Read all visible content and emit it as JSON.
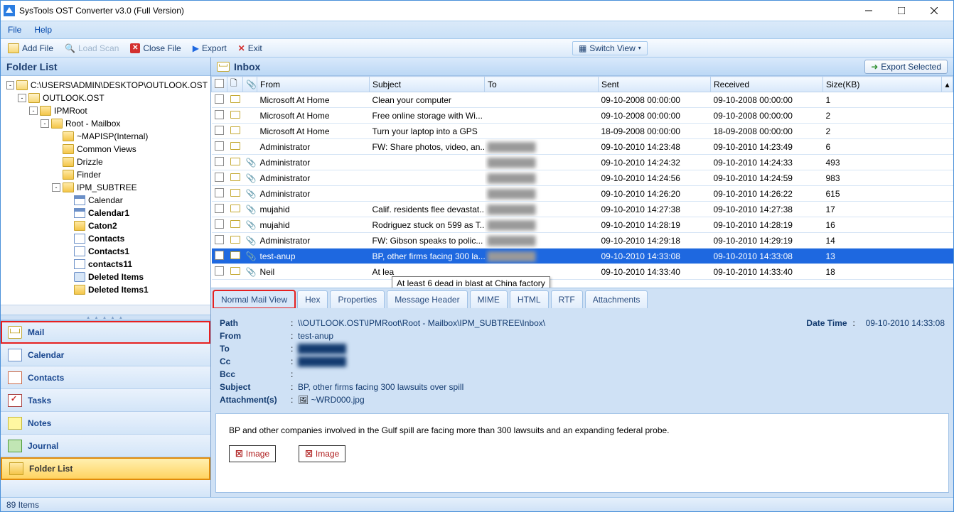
{
  "window": {
    "title": "SysTools OST Converter v3.0 (Full Version)"
  },
  "menu": {
    "file": "File",
    "help": "Help"
  },
  "toolbar": {
    "add_file": "Add File",
    "load_scan": "Load Scan",
    "close_file": "Close File",
    "export": "Export",
    "exit": "Exit",
    "switch_view": "Switch View"
  },
  "left": {
    "header": "Folder List",
    "tree": [
      {
        "depth": 0,
        "exp": "-",
        "icon": "folder-open",
        "label": "C:\\USERS\\ADMIN\\DESKTOP\\OUTLOOK.OST"
      },
      {
        "depth": 1,
        "exp": "-",
        "icon": "folder-open",
        "label": "OUTLOOK.OST"
      },
      {
        "depth": 2,
        "exp": "-",
        "icon": "folder",
        "label": "IPMRoot"
      },
      {
        "depth": 3,
        "exp": "-",
        "icon": "folder",
        "label": "Root - Mailbox"
      },
      {
        "depth": 4,
        "exp": "",
        "icon": "folder",
        "label": "~MAPISP(Internal)"
      },
      {
        "depth": 4,
        "exp": "",
        "icon": "folder",
        "label": "Common Views"
      },
      {
        "depth": 4,
        "exp": "",
        "icon": "folder",
        "label": "Drizzle"
      },
      {
        "depth": 4,
        "exp": "",
        "icon": "folder",
        "label": "Finder"
      },
      {
        "depth": 4,
        "exp": "-",
        "icon": "folder",
        "label": "IPM_SUBTREE"
      },
      {
        "depth": 5,
        "exp": "",
        "icon": "cal",
        "label": "Calendar"
      },
      {
        "depth": 5,
        "exp": "",
        "icon": "cal",
        "label": "Calendar1",
        "bold": true
      },
      {
        "depth": 5,
        "exp": "",
        "icon": "folder",
        "label": "Caton2",
        "bold": true
      },
      {
        "depth": 5,
        "exp": "",
        "icon": "contacts",
        "label": "Contacts",
        "bold": true
      },
      {
        "depth": 5,
        "exp": "",
        "icon": "contacts",
        "label": "Contacts1",
        "bold": true
      },
      {
        "depth": 5,
        "exp": "",
        "icon": "contacts",
        "label": "contacts11",
        "bold": true
      },
      {
        "depth": 5,
        "exp": "",
        "icon": "trash",
        "label": "Deleted Items",
        "bold": true
      },
      {
        "depth": 5,
        "exp": "",
        "icon": "folder",
        "label": "Deleted Items1",
        "bold": true
      }
    ],
    "nav": [
      {
        "label": "Mail",
        "icon": "mail",
        "sel": false,
        "hl": true
      },
      {
        "label": "Calendar",
        "icon": "cal"
      },
      {
        "label": "Contacts",
        "icon": "con"
      },
      {
        "label": "Tasks",
        "icon": "task"
      },
      {
        "label": "Notes",
        "icon": "note"
      },
      {
        "label": "Journal",
        "icon": "jour"
      },
      {
        "label": "Folder List",
        "icon": "fl",
        "sel": true
      }
    ]
  },
  "list": {
    "title": "Inbox",
    "export_selected": "Export Selected",
    "cols": {
      "from": "From",
      "subject": "Subject",
      "to": "To",
      "sent": "Sent",
      "received": "Received",
      "size": "Size(KB)"
    },
    "rows": [
      {
        "from": "Microsoft At Home",
        "subject": "Clean your computer",
        "to": "",
        "sent": "09-10-2008 00:00:00",
        "received": "09-10-2008 00:00:00",
        "size": "1",
        "att": false
      },
      {
        "from": "Microsoft At Home",
        "subject": "Free online storage with Wi...",
        "to": "",
        "sent": "09-10-2008 00:00:00",
        "received": "09-10-2008 00:00:00",
        "size": "2",
        "att": false
      },
      {
        "from": "Microsoft At Home",
        "subject": "Turn your laptop into a GPS",
        "to": "",
        "sent": "18-09-2008 00:00:00",
        "received": "18-09-2008 00:00:00",
        "size": "2",
        "att": false
      },
      {
        "from": "Administrator",
        "subject": "FW: Share photos, video, an...",
        "to": "████████",
        "sent": "09-10-2010 14:23:48",
        "received": "09-10-2010 14:23:49",
        "size": "6",
        "att": false
      },
      {
        "from": "Administrator",
        "subject": "",
        "to": "████████",
        "sent": "09-10-2010 14:24:32",
        "received": "09-10-2010 14:24:33",
        "size": "493",
        "att": true
      },
      {
        "from": "Administrator",
        "subject": "",
        "to": "████████",
        "sent": "09-10-2010 14:24:56",
        "received": "09-10-2010 14:24:59",
        "size": "983",
        "att": true
      },
      {
        "from": "Administrator",
        "subject": "",
        "to": "████████",
        "sent": "09-10-2010 14:26:20",
        "received": "09-10-2010 14:26:22",
        "size": "615",
        "att": true
      },
      {
        "from": "mujahid",
        "subject": "Calif. residents flee devastat...",
        "to": "████████",
        "sent": "09-10-2010 14:27:38",
        "received": "09-10-2010 14:27:38",
        "size": "17",
        "att": true
      },
      {
        "from": "mujahid",
        "subject": "Rodriguez stuck on 599 as T...",
        "to": "████████",
        "sent": "09-10-2010 14:28:19",
        "received": "09-10-2010 14:28:19",
        "size": "16",
        "att": true
      },
      {
        "from": "Administrator",
        "subject": "FW: Gibson speaks to polic...",
        "to": "████████",
        "sent": "09-10-2010 14:29:18",
        "received": "09-10-2010 14:29:19",
        "size": "14",
        "att": true
      },
      {
        "from": "test-anup",
        "subject": "BP, other firms facing 300 la...",
        "to": "████████",
        "sent": "09-10-2010 14:33:08",
        "received": "09-10-2010 14:33:08",
        "size": "13",
        "att": true,
        "sel": true
      },
      {
        "from": "Neil",
        "subject": "At lea",
        "to": "",
        "sent": "09-10-2010 14:33:40",
        "received": "09-10-2010 14:33:40",
        "size": "18",
        "att": true
      }
    ],
    "tooltip": "At least 6 dead in blast at China factory"
  },
  "tabs": [
    "Normal Mail View",
    "Hex",
    "Properties",
    "Message Header",
    "MIME",
    "HTML",
    "RTF",
    "Attachments"
  ],
  "preview": {
    "path_lbl": "Path",
    "path": "\\\\OUTLOOK.OST\\IPMRoot\\Root - Mailbox\\IPM_SUBTREE\\Inbox\\",
    "dt_lbl": "Date Time",
    "dt": "09-10-2010 14:33:08",
    "from_lbl": "From",
    "from": "test-anup",
    "to_lbl": "To",
    "to": "████████",
    "cc_lbl": "Cc",
    "cc": "████████",
    "bcc_lbl": "Bcc",
    "bcc": "",
    "subject_lbl": "Subject",
    "subject": "BP, other firms facing 300 lawsuits over spill",
    "att_lbl": "Attachment(s)",
    "att": "~WRD000.jpg",
    "body": "BP and other companies involved in the Gulf spill are facing more than 300 lawsuits and an expanding federal probe.",
    "img_lbl": "Image"
  },
  "status": {
    "items": "89 Items"
  }
}
